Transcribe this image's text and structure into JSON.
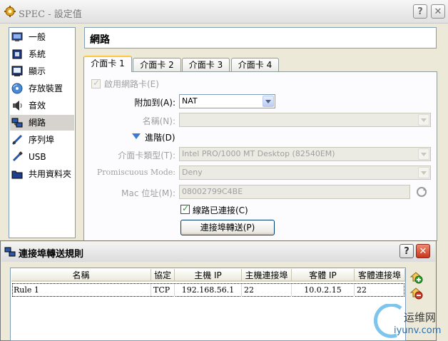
{
  "window": {
    "title": "SPEC - 設定值",
    "help_btn": "?",
    "close_btn": "✕"
  },
  "sidebar": {
    "items": [
      {
        "label": "一般",
        "icon": "monitor-icon"
      },
      {
        "label": "系統",
        "icon": "chip-icon"
      },
      {
        "label": "顯示",
        "icon": "display-icon"
      },
      {
        "label": "存放裝置",
        "icon": "disk-icon"
      },
      {
        "label": "音效",
        "icon": "speaker-icon"
      },
      {
        "label": "網路",
        "icon": "network-icon",
        "selected": true
      },
      {
        "label": "序列埠",
        "icon": "serial-icon"
      },
      {
        "label": "USB",
        "icon": "usb-icon"
      },
      {
        "label": "共用資料夾",
        "icon": "folder-icon"
      }
    ]
  },
  "header": {
    "title": "網路"
  },
  "tabs": [
    {
      "label": "介面卡 1",
      "active": true
    },
    {
      "label": "介面卡 2"
    },
    {
      "label": "介面卡 3"
    },
    {
      "label": "介面卡 4"
    }
  ],
  "adapter": {
    "enable_label": "啟用網路卡(E)",
    "attached_label": "附加到(A):",
    "attached_value": "NAT",
    "name_label": "名稱(N):",
    "name_value": "",
    "advanced_label": "進階(D)",
    "type_label": "介面卡類型(T):",
    "type_value": "Intel PRO/1000 MT Desktop (82540EM)",
    "promisc_label": "Promiscuous Mode:",
    "promisc_value": "Deny",
    "mac_label": "Mac 位址(M):",
    "mac_value": "08002799C4BE",
    "cable_label": "線路已連接(C)",
    "port_forward_btn": "連接埠轉送(P)"
  },
  "dialog": {
    "title": "連接埠轉送規則",
    "help_btn": "?",
    "close_btn": "✕",
    "columns": [
      "名稱",
      "協定",
      "主機 IP",
      "主機連接埠",
      "客體 IP",
      "客體連接埠"
    ],
    "rows": [
      [
        "Rule 1",
        "TCP",
        "192.168.56.1",
        "22",
        "10.0.2.15",
        "22"
      ]
    ]
  },
  "watermark": {
    "line1": "运维网",
    "line2": "iyunv.com"
  },
  "colors": {
    "accent_tab": "#ffc83c",
    "close_red": "#d9442b",
    "check_green": "#21a121"
  }
}
